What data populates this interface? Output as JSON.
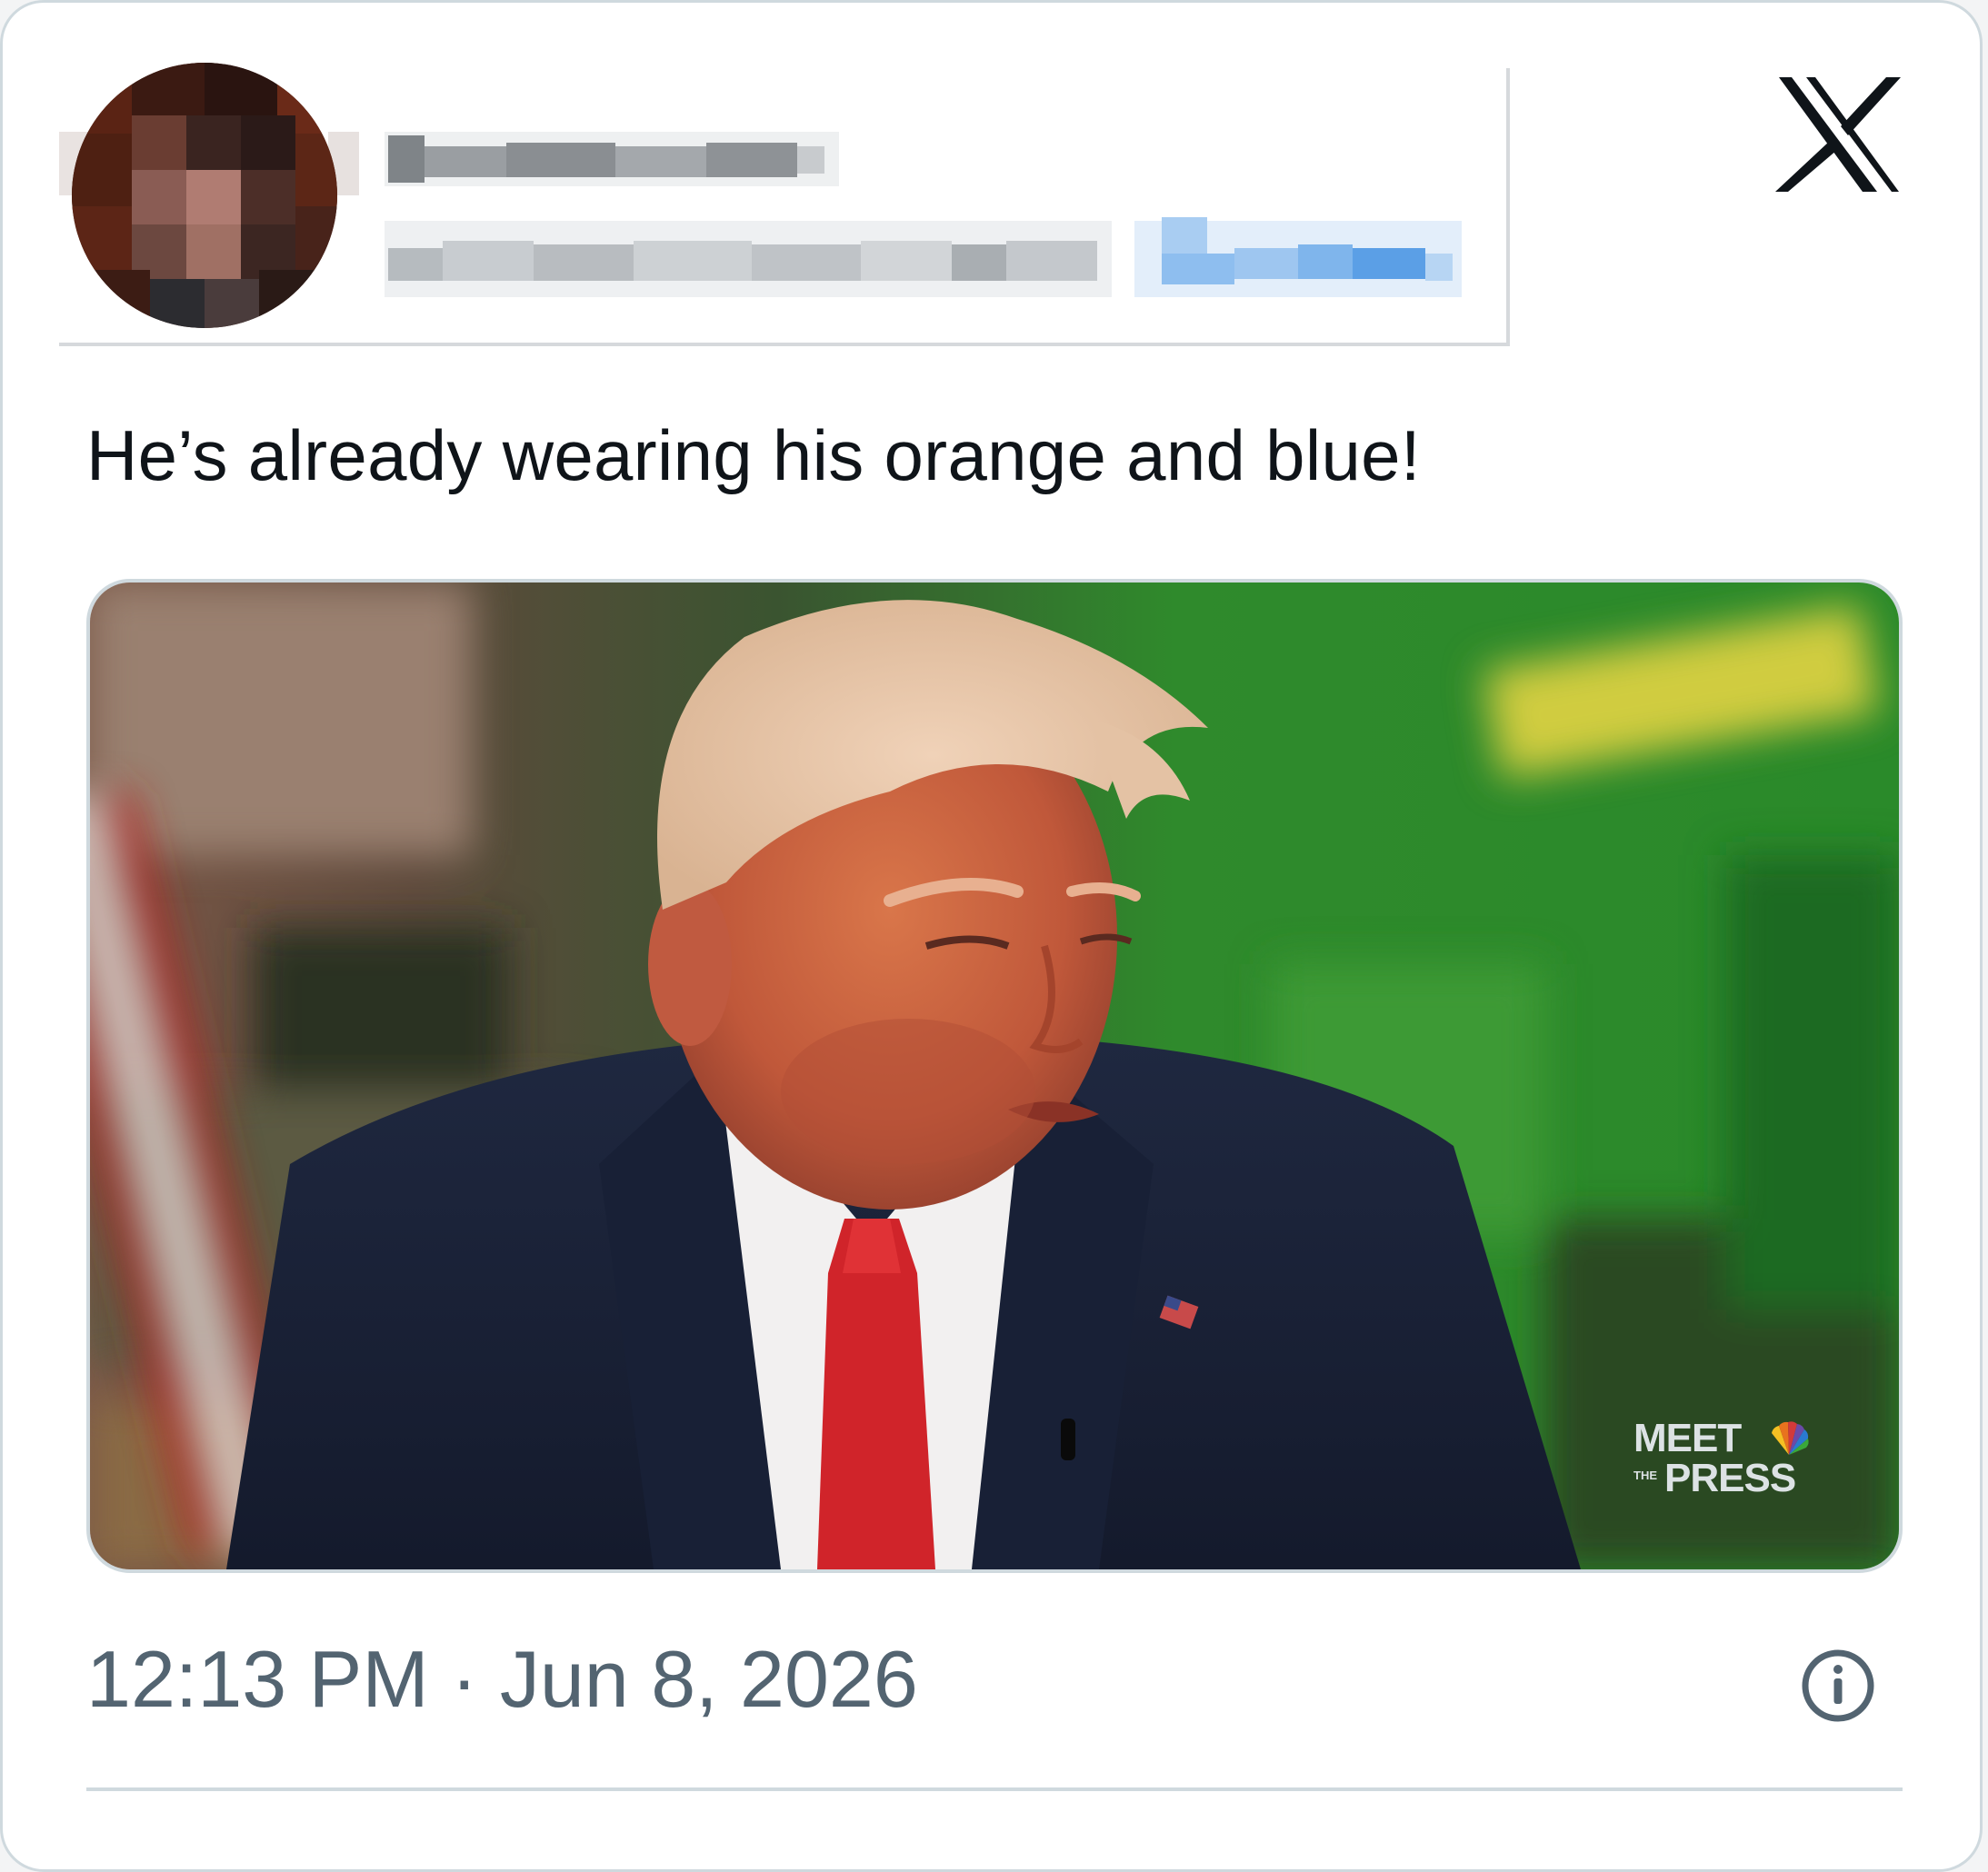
{
  "post": {
    "author": {
      "display_name": "",
      "handle": "",
      "follow_label": "",
      "avatar_icon": "avatar-pixelated"
    },
    "platform_icon": "x-logo-icon",
    "text": "He’s already wearing his orange and blue!",
    "media": {
      "watermark_meet": "MEET",
      "watermark_the": "THE",
      "watermark_press": "PRESS"
    },
    "timestamp": "12:13 PM · Jun 8, 2026",
    "info_icon": "info-icon"
  },
  "colors": {
    "text_primary": "#0f1419",
    "text_secondary": "#536471",
    "border": "#cfd9de",
    "link_blue": "#1d9bf0"
  }
}
